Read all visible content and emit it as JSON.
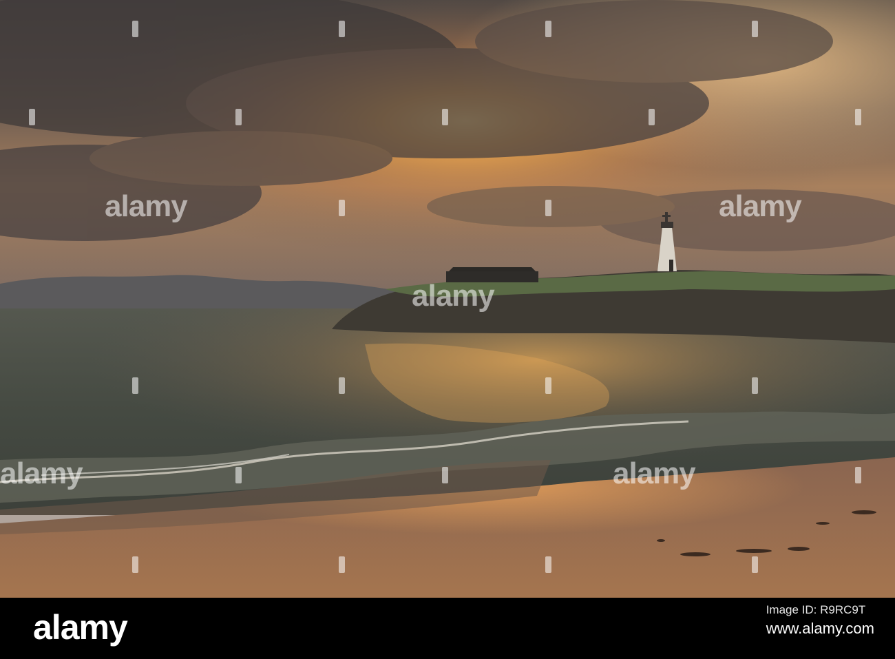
{
  "photo": {
    "subject": "",
    "watermark_text": "alamy",
    "colors": {
      "sky_top": "#5a5350",
      "sun_glow": "#f2a94a",
      "sea": "#4a4e46",
      "sand": "#9c7152",
      "tower": "#d9d3c8"
    }
  },
  "footer": {
    "logo": "alamy",
    "image_id_label": "Image ID: R9RC9T",
    "site": "www.alamy.com"
  }
}
